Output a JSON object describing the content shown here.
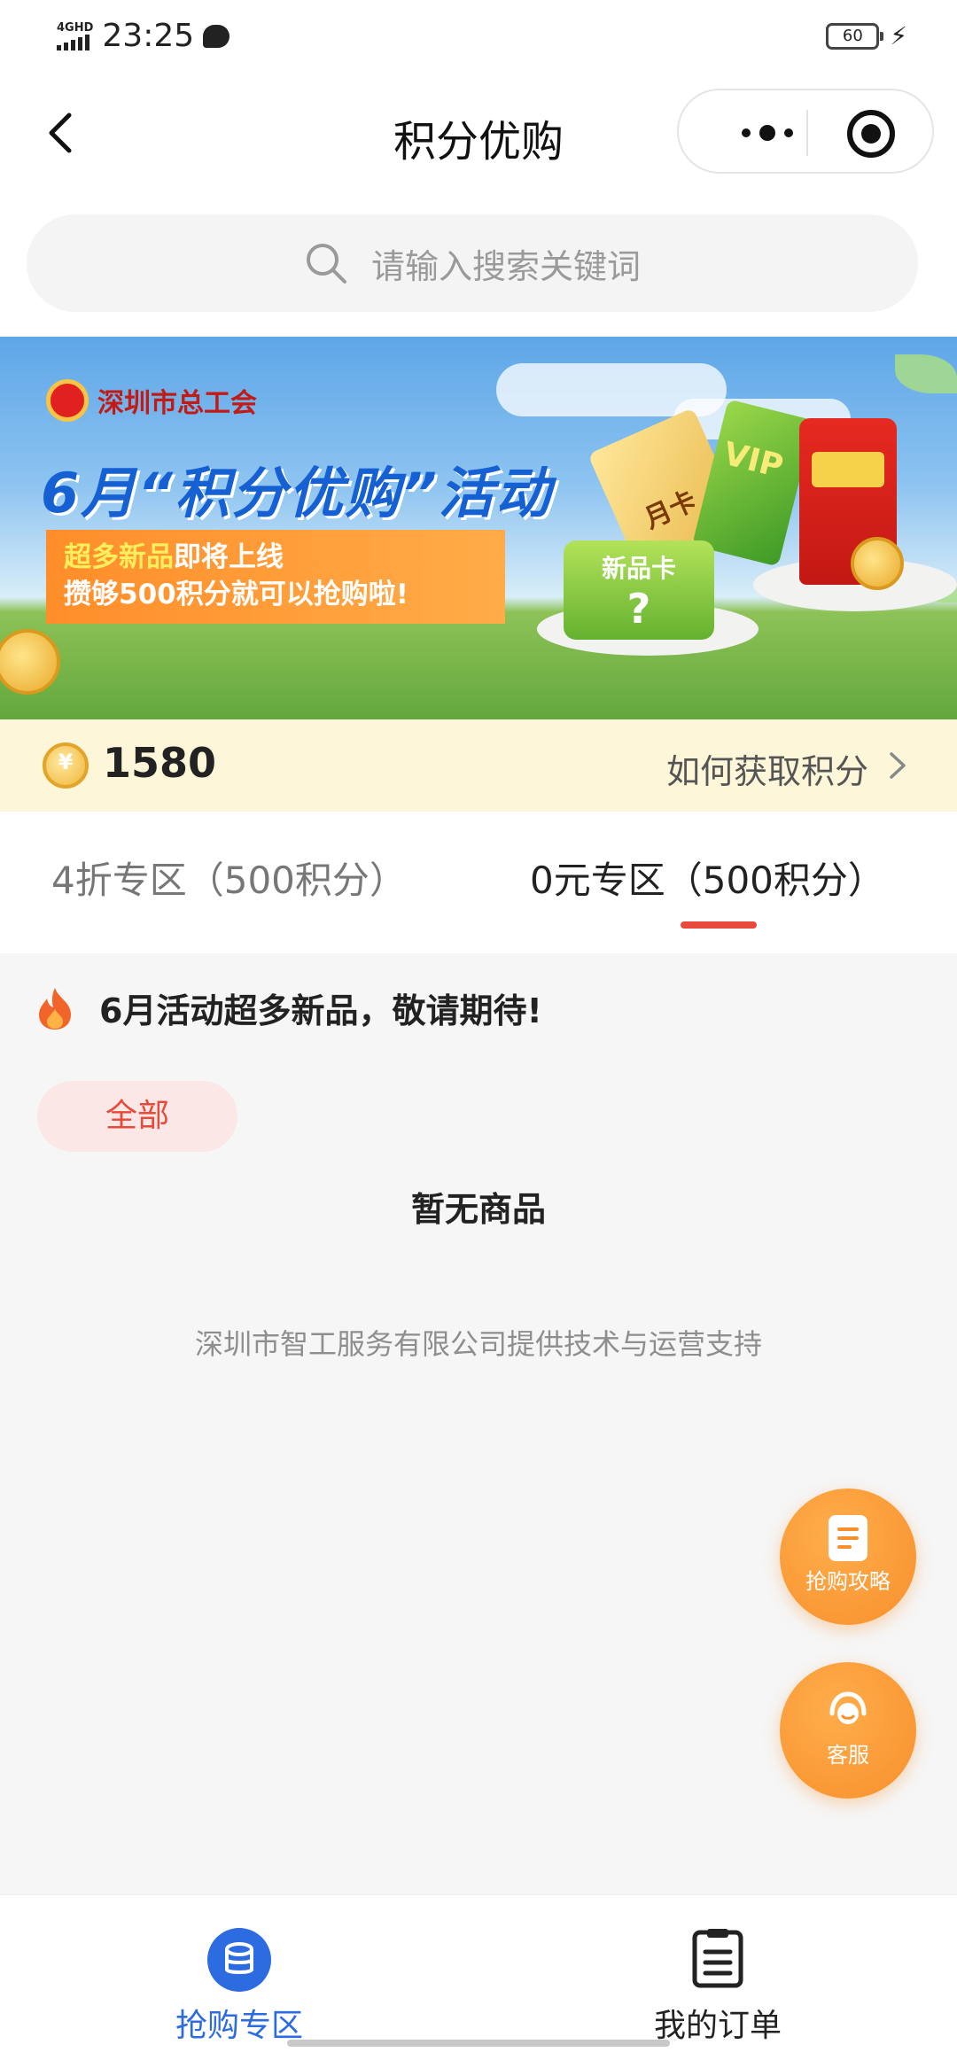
{
  "status_bar": {
    "network": "4GHD",
    "time": "23:25",
    "battery": "60"
  },
  "nav": {
    "title": "积分优购",
    "back_icon": "chevron-left-icon",
    "more_icon": "more-dots-icon",
    "close_icon": "target-icon"
  },
  "search": {
    "placeholder": "请输入搜索关键词",
    "icon": "search-icon"
  },
  "banner": {
    "org_name": "深圳市总工会",
    "title": "6月“积分优购”活动",
    "line1_highlight": "超多新品",
    "line1_rest": "即将上线",
    "line2": "攒够500积分就可以抢购啦!",
    "card_green_label": "新品卡",
    "card_green_mark": "?",
    "card_gold_label": "月卡",
    "card_vip_label": "VIP"
  },
  "points": {
    "value": "1580",
    "link_label": "如何获取积分"
  },
  "tabs": [
    {
      "label": "4折专区（500积分）",
      "active": false
    },
    {
      "label": "0元专区（500积分）",
      "active": true
    }
  ],
  "notice": {
    "text": "6月活动超多新品，敬请期待!",
    "icon": "flame-icon"
  },
  "filter": {
    "chip_label": "全部"
  },
  "empty_state": "暂无商品",
  "footer_note": "深圳市智工服务有限公司提供技术与运营支持",
  "floating": [
    {
      "label": "抢购攻略",
      "icon": "document-icon"
    },
    {
      "label": "客服",
      "icon": "headset-icon"
    }
  ],
  "tabbar": [
    {
      "label": "抢购专区",
      "icon": "coins-stack-icon",
      "active": true
    },
    {
      "label": "我的订单",
      "icon": "clipboard-icon",
      "active": false
    }
  ],
  "colors": {
    "accent_blue": "#2d6be0",
    "accent_red": "#e84a3c",
    "fab_orange": "#f7902b",
    "points_bg": "#fdf6d9"
  }
}
